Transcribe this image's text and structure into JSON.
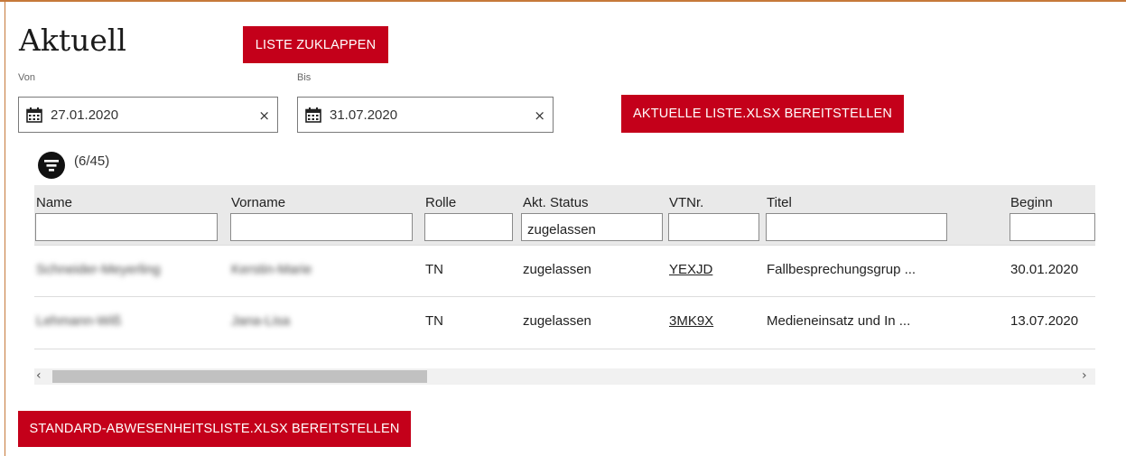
{
  "page": {
    "title": "Aktuell"
  },
  "buttons": {
    "collapse": "LISTE ZUKLAPPEN",
    "export_current": "AKTUELLE LISTE.XLSX BEREITSTELLEN",
    "export_standard": "STANDARD-ABWESENHEITSLISTE.XLSX BEREITSTELLEN"
  },
  "date_range": {
    "from_label": "Von",
    "from_value": "27.01.2020",
    "to_label": "Bis",
    "to_value": "31.07.2020",
    "clear_symbol": "×"
  },
  "filter": {
    "count": "(6/45)"
  },
  "table": {
    "columns": [
      "Name",
      "Vorname",
      "Rolle",
      "Akt. Status",
      "VTNr.",
      "Titel",
      "Beginn"
    ],
    "filters": {
      "status": "zugelassen"
    },
    "rows": [
      {
        "name": "Schneider-Meyerling",
        "vorname": "Kerstin-Marie",
        "rolle": "TN",
        "status": "zugelassen",
        "vtnr": "YEXJD",
        "titel": "Fallbesprechungsgrup ...",
        "beginn": "30.01.2020"
      },
      {
        "name": "Lehmann-Wiß",
        "vorname": "Jana-Lisa",
        "rolle": "TN",
        "status": "zugelassen",
        "vtnr": "3MK9X",
        "titel": "Medieneinsatz und In ...",
        "beginn": "13.07.2020"
      }
    ]
  },
  "scrollbar": {
    "left": "‹",
    "right": "›"
  },
  "colors": {
    "accent": "#c4001a",
    "header_bg": "#e9e9e9"
  }
}
